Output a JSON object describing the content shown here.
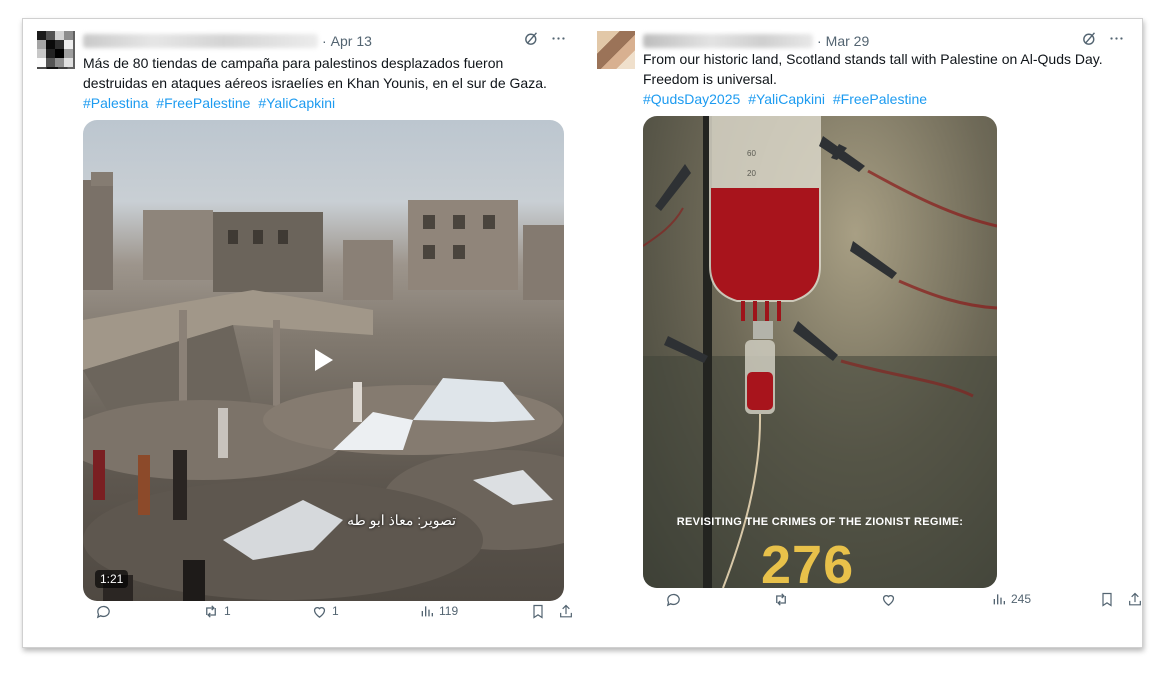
{
  "tweets": [
    {
      "date": "Apr 13",
      "dot": "·",
      "text": "Más de 80 tiendas de campaña para palestinos desplazados fueron destruidas en ataques aéreos israelíes en Khan Younis, en el sur de Gaza.",
      "hashtags": [
        "#Palestina",
        "#FreePalestine",
        "#YaliCapkini"
      ],
      "media": {
        "type": "video",
        "duration": "1:21",
        "overlay_text": "تصوير: معاذ ابو طه"
      },
      "stats": {
        "replies": "",
        "reposts": "1",
        "likes": "1",
        "views": "119"
      },
      "icons": [
        "grok-icon",
        "more-icon",
        "reply-icon",
        "repost-icon",
        "like-icon",
        "views-icon",
        "bookmark-icon",
        "share-icon"
      ]
    },
    {
      "date": "Mar 29",
      "dot": "·",
      "text": "From our historic land, Scotland stands tall with Palestine on Al-Quds Day. Freedom is universal.",
      "hashtags": [
        "#QudsDay2025",
        "#YaliCapkini",
        "#FreePalestine"
      ],
      "media": {
        "type": "image",
        "caption": "REVISITING THE CRIMES OF THE ZIONIST REGIME:",
        "number": "276",
        "iv_scale": [
          "60",
          "20"
        ]
      },
      "stats": {
        "replies": "",
        "reposts": "",
        "likes": "",
        "views": "245"
      },
      "icons": [
        "grok-icon",
        "more-icon",
        "reply-icon",
        "repost-icon",
        "like-icon",
        "views-icon",
        "bookmark-icon",
        "share-icon"
      ]
    }
  ],
  "colors": {
    "link": "#1d9bf0",
    "muted": "#536471",
    "text": "#0f1419"
  }
}
